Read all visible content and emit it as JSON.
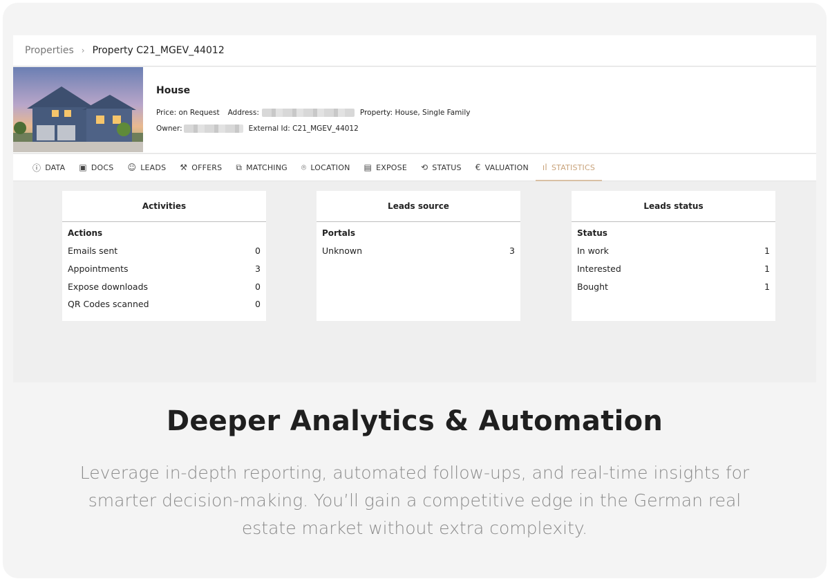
{
  "breadcrumb": {
    "root": "Properties",
    "separator": "›",
    "current": "Property C21_MGEV_44012"
  },
  "property": {
    "title": "House",
    "price": "Price: on Request",
    "address_label": "Address:",
    "property_type": "Property: House, Single Family",
    "owner_label": "Owner:",
    "external_id": "External Id: C21_MGEV_44012"
  },
  "tabs": [
    {
      "label": "DATA",
      "icon": "alert-circle-icon",
      "glyph": "ⓘ"
    },
    {
      "label": "DOCS",
      "icon": "document-icon",
      "glyph": "▣"
    },
    {
      "label": "LEADS",
      "icon": "smiley-icon",
      "glyph": "☺"
    },
    {
      "label": "OFFERS",
      "icon": "gavel-icon",
      "glyph": "⚒"
    },
    {
      "label": "MATCHING",
      "icon": "copy-icon",
      "glyph": "⧉"
    },
    {
      "label": "LOCATION",
      "icon": "location-pin-icon",
      "glyph": "⌾"
    },
    {
      "label": "EXPOSE",
      "icon": "print-doc-icon",
      "glyph": "▤"
    },
    {
      "label": "STATUS",
      "icon": "refresh-icon",
      "glyph": "⟲"
    },
    {
      "label": "VALUATION",
      "icon": "euro-icon",
      "glyph": "€"
    },
    {
      "label": "STATISTICS",
      "icon": "bar-chart-icon",
      "glyph": "ıl"
    }
  ],
  "active_tab": "STATISTICS",
  "accent_color": "#c8a27a",
  "panels": {
    "activities": {
      "title": "Activities",
      "section": "Actions",
      "rows": [
        {
          "label": "Emails sent",
          "value": "0"
        },
        {
          "label": "Appointments",
          "value": "3"
        },
        {
          "label": "Expose downloads",
          "value": "0"
        },
        {
          "label": "QR Codes scanned",
          "value": "0"
        }
      ]
    },
    "leads_source": {
      "title": "Leads source",
      "section": "Portals",
      "rows": [
        {
          "label": "Unknown",
          "value": "3"
        }
      ]
    },
    "leads_status": {
      "title": "Leads status",
      "section": "Status",
      "rows": [
        {
          "label": "In work",
          "value": "1"
        },
        {
          "label": "Interested",
          "value": "1"
        },
        {
          "label": "Bought",
          "value": "1"
        }
      ]
    }
  },
  "marketing": {
    "headline": "Deeper Analytics & Automation",
    "body": "Leverage in-depth reporting, automated follow-ups, and real-time insights for smarter decision-making. You’ll gain a competitive edge in the German real estate market without extra complexity."
  }
}
